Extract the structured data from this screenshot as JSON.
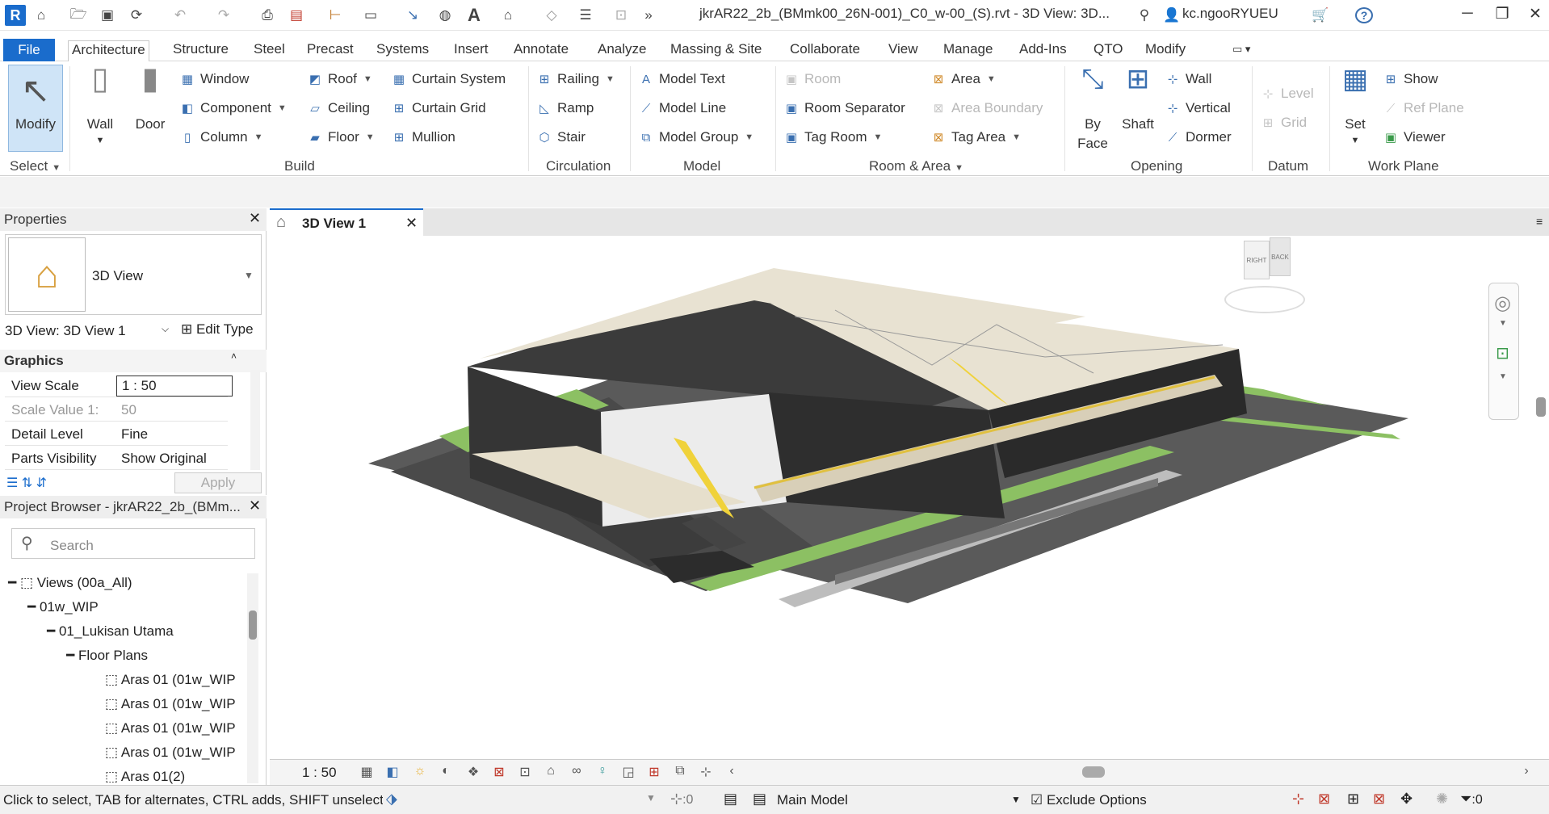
{
  "app": {
    "logo_letter": "R",
    "title": "jkrAR22_2b_(BMmk00_26N-001)_C0_w-00_(S).rvt - 3D View: 3D...",
    "user": "kc.ngooRYUEU"
  },
  "menu": {
    "file": "File",
    "tabs": [
      "Architecture",
      "Structure",
      "Steel",
      "Precast",
      "Systems",
      "Insert",
      "Annotate",
      "Analyze",
      "Massing & Site",
      "Collaborate",
      "View",
      "Manage",
      "Add-Ins",
      "QTO",
      "Modify"
    ],
    "active_tab": "Architecture"
  },
  "ribbon": {
    "select": {
      "modify": "Modify",
      "group": "Select"
    },
    "build": {
      "wall": "Wall",
      "door": "Door",
      "window": "Window",
      "component": "Component",
      "column": "Column",
      "roof": "Roof",
      "ceiling": "Ceiling",
      "floor": "Floor",
      "curtain_system": "Curtain  System",
      "curtain_grid": "Curtain  Grid",
      "mullion": "Mullion",
      "group": "Build"
    },
    "circulation": {
      "railing": "Railing",
      "ramp": "Ramp",
      "stair": "Stair",
      "group": "Circulation"
    },
    "model": {
      "model_text": "Model  Text",
      "model_line": "Model  Line",
      "model_group": "Model  Group",
      "group": "Model"
    },
    "room_area": {
      "room": "Room",
      "room_separator": "Room  Separator",
      "tag_room": "Tag  Room",
      "area": "Area",
      "area_boundary": "Area  Boundary",
      "tag_area": "Tag  Area",
      "group": "Room & Area"
    },
    "opening": {
      "by_face_1": "By",
      "by_face_2": "Face",
      "shaft": "Shaft",
      "wall": "Wall",
      "vertical": "Vertical",
      "dormer": "Dormer",
      "group": "Opening"
    },
    "datum": {
      "level": "Level",
      "grid": "Grid",
      "group": "Datum"
    },
    "work_plane": {
      "set": "Set",
      "show": "Show",
      "ref_plane": "Ref  Plane",
      "viewer": "Viewer",
      "group": "Work Plane"
    }
  },
  "properties": {
    "title": "Properties",
    "type_name": "3D View",
    "instance": "3D View: 3D View 1",
    "edit_type": "Edit Type",
    "section": "Graphics",
    "rows": [
      {
        "label": "View Scale",
        "value": "1 : 50"
      },
      {
        "label": "Scale Value    1:",
        "value": "50"
      },
      {
        "label": "Detail Level",
        "value": "Fine"
      },
      {
        "label": "Parts Visibility",
        "value": "Show Original"
      }
    ],
    "apply": "Apply"
  },
  "browser": {
    "title": "Project Browser - jkrAR22_2b_(BMm...",
    "search_placeholder": "Search",
    "items": [
      {
        "label": "Views (00a_All)"
      },
      {
        "label": "01w_WIP"
      },
      {
        "label": "01_Lukisan Utama"
      },
      {
        "label": "Floor Plans"
      },
      {
        "label": "Aras 01 (01w_WIP"
      },
      {
        "label": "Aras 01 (01w_WIP"
      },
      {
        "label": "Aras 01 (01w_WIP"
      },
      {
        "label": "Aras 01 (01w_WIP"
      },
      {
        "label": "Aras 01(2)"
      }
    ]
  },
  "view": {
    "tab_label": "3D View 1",
    "scale": "1 : 50",
    "cube_right": "RIGHT",
    "cube_back": "BACK"
  },
  "status": {
    "hint": "Click to select, TAB for alternates, CTRL adds, SHIFT unselect",
    "worksets_count": ":0",
    "model": "Main Model",
    "exclude_options": "Exclude Options",
    "filter_count": ":0"
  },
  "colors": {
    "accent": "#1a6ccc",
    "grass": "#8cc063",
    "roof": "#e8e2d2",
    "facade": "#3b3b3b",
    "road": "#555555"
  }
}
